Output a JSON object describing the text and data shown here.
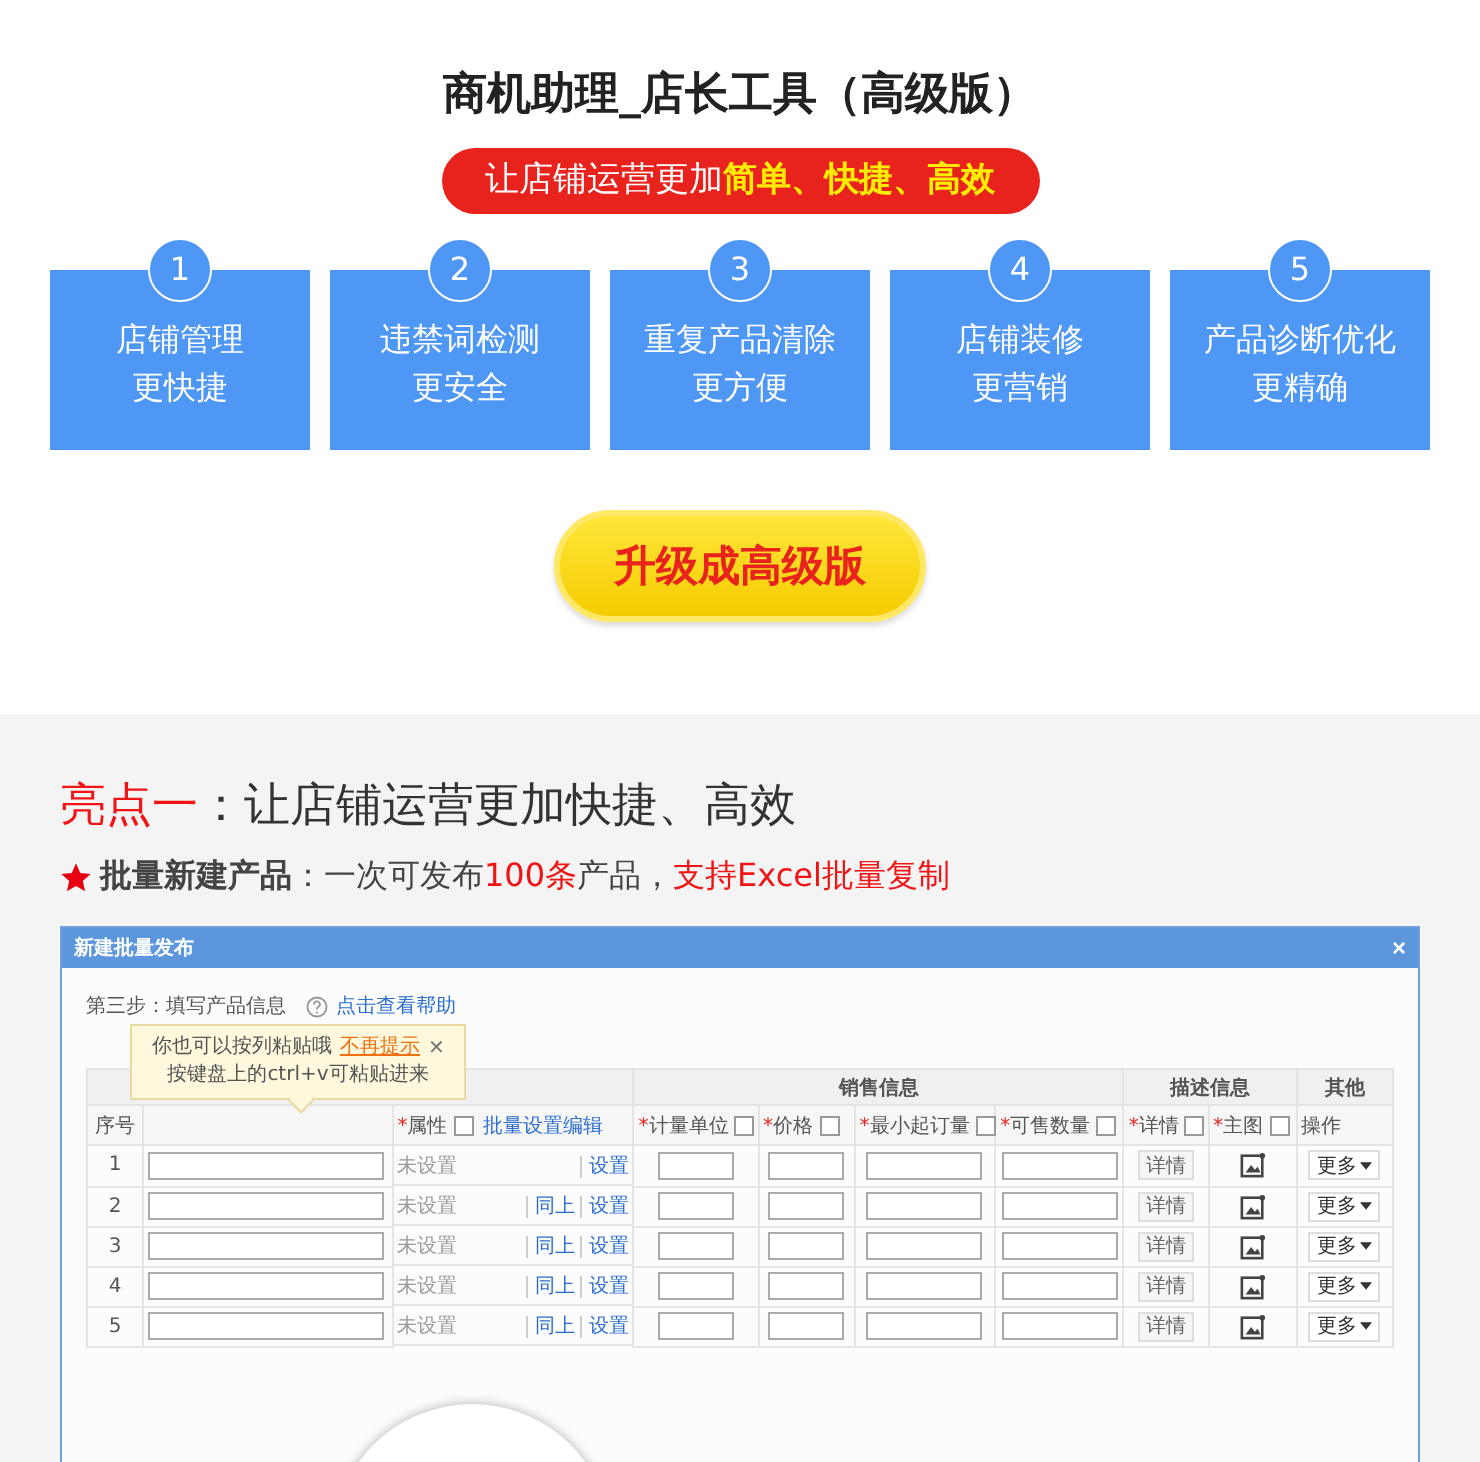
{
  "header": {
    "title": "商机助理_店长工具（高级版）",
    "slogan": [
      {
        "text": "让店铺运营更加",
        "kind": "plain"
      },
      {
        "text": "简单、快捷、高效",
        "kind": "highlight"
      }
    ]
  },
  "features": [
    {
      "number": "1",
      "lines": [
        "店铺管理",
        "更快捷"
      ]
    },
    {
      "number": "2",
      "lines": [
        "违禁词检测",
        "更安全"
      ]
    },
    {
      "number": "3",
      "lines": [
        "重复产品清除",
        "更方便"
      ]
    },
    {
      "number": "4",
      "lines": [
        "店铺装修",
        "更营销"
      ]
    },
    {
      "number": "5",
      "lines": [
        "产品诊断优化",
        "更精确"
      ]
    }
  ],
  "upgrade_button": "升级成高级版",
  "highlight": {
    "heading": [
      {
        "text": "亮点一",
        "kind": "highlight"
      },
      {
        "text": "：让店铺运营更加快捷、高效",
        "kind": "plain"
      }
    ],
    "subline": [
      {
        "text": "批量新建产品",
        "kind": "bold"
      },
      {
        "text": "：一次可发布",
        "kind": "plain"
      },
      {
        "text": "100条",
        "kind": "highlight"
      },
      {
        "text": "产品，",
        "kind": "plain"
      },
      {
        "text": "支持Excel批量复制",
        "kind": "highlight"
      }
    ]
  },
  "dialog": {
    "title": "新建批量发布",
    "close": "×",
    "step": "第三步：填写产品信息",
    "help_link": "点击查看帮助",
    "tooltip": {
      "text": "你也可以按列粘贴哦",
      "dismiss": "不再提示",
      "close": "✕",
      "hint": "按键盘上的ctrl+v可粘贴进来"
    },
    "groups": [
      {
        "label": "销售信息"
      },
      {
        "label": "描述信息"
      },
      {
        "label": "其他"
      }
    ],
    "columns": [
      {
        "label": "序号",
        "required": false
      },
      {
        "required": false
      },
      {
        "label": "属性",
        "required": true,
        "checked": false,
        "action": "批量设置编辑"
      },
      {
        "label": "计量单位",
        "required": true,
        "checked": false
      },
      {
        "label": "价格",
        "required": true,
        "checked": false
      },
      {
        "label": "最小起订量",
        "required": true,
        "checked": false
      },
      {
        "label": "可售数量",
        "required": true,
        "checked": false
      },
      {
        "label": "详情",
        "required": true,
        "checked": false
      },
      {
        "label": "主图",
        "required": true,
        "checked": false
      },
      {
        "label": "操作",
        "required": false
      }
    ],
    "required_mark": "*",
    "rows": [
      {
        "no": "1",
        "attr": "未设置",
        "links": [
          "设置"
        ],
        "detail": "详情",
        "more": "更多"
      },
      {
        "no": "2",
        "attr": "未设置",
        "links": [
          "同上",
          "设置"
        ],
        "detail": "详情",
        "more": "更多"
      },
      {
        "no": "3",
        "attr": "未设置",
        "links": [
          "同上",
          "设置"
        ],
        "detail": "详情",
        "more": "更多"
      },
      {
        "no": "4",
        "attr": "未设置",
        "links": [
          "同上",
          "设置"
        ],
        "detail": "详情",
        "more": "更多"
      },
      {
        "no": "5",
        "attr": "未设置",
        "links": [
          "同上",
          "设置"
        ],
        "detail": "详情",
        "more": "更多"
      }
    ]
  }
}
